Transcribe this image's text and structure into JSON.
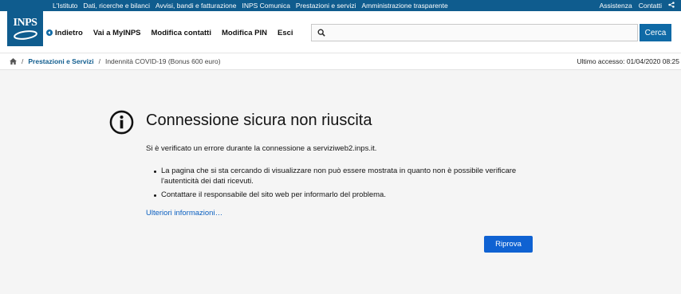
{
  "topbar": {
    "links": [
      "L'Istituto",
      "Dati, ricerche e bilanci",
      "Avvisi, bandi e fatturazione",
      "INPS Comunica",
      "Prestazioni e servizi",
      "Amministrazione trasparente"
    ],
    "right_links": [
      "Assistenza",
      "Contatti"
    ],
    "share_icon": "share-icon"
  },
  "logo": {
    "text": "INPS"
  },
  "nav": {
    "back_label": "Indietro",
    "items": [
      "Vai a MyINPS",
      "Modifica contatti",
      "Modifica PIN",
      "Esci"
    ]
  },
  "search": {
    "value": "",
    "placeholder": "",
    "button_label": "Cerca",
    "icon": "search-icon"
  },
  "breadcrumb": {
    "home_icon": "home-icon",
    "section": "Prestazioni e Servizi",
    "current": "Indennità COVID-19 (Bonus 600 euro)",
    "last_access": "Ultimo accesso: 01/04/2020 08:25"
  },
  "error": {
    "icon": "info-icon",
    "title": "Connessione sicura non riuscita",
    "description": "Si è verificato un errore durante la connessione a serviziweb2.inps.it.",
    "bullets": [
      "La pagina che si sta cercando di visualizzare non può essere mostrata in quanto non è possibile verificare l'autenticità dei dati ricevuti.",
      "Contattare il responsabile del sito web per informarlo del problema."
    ],
    "more_info": "Ulteriori informazioni…",
    "retry_label": "Riprova"
  },
  "colors": {
    "brand": "#0f5c8e",
    "link": "#0a5fc0",
    "button": "#0f62d2"
  }
}
